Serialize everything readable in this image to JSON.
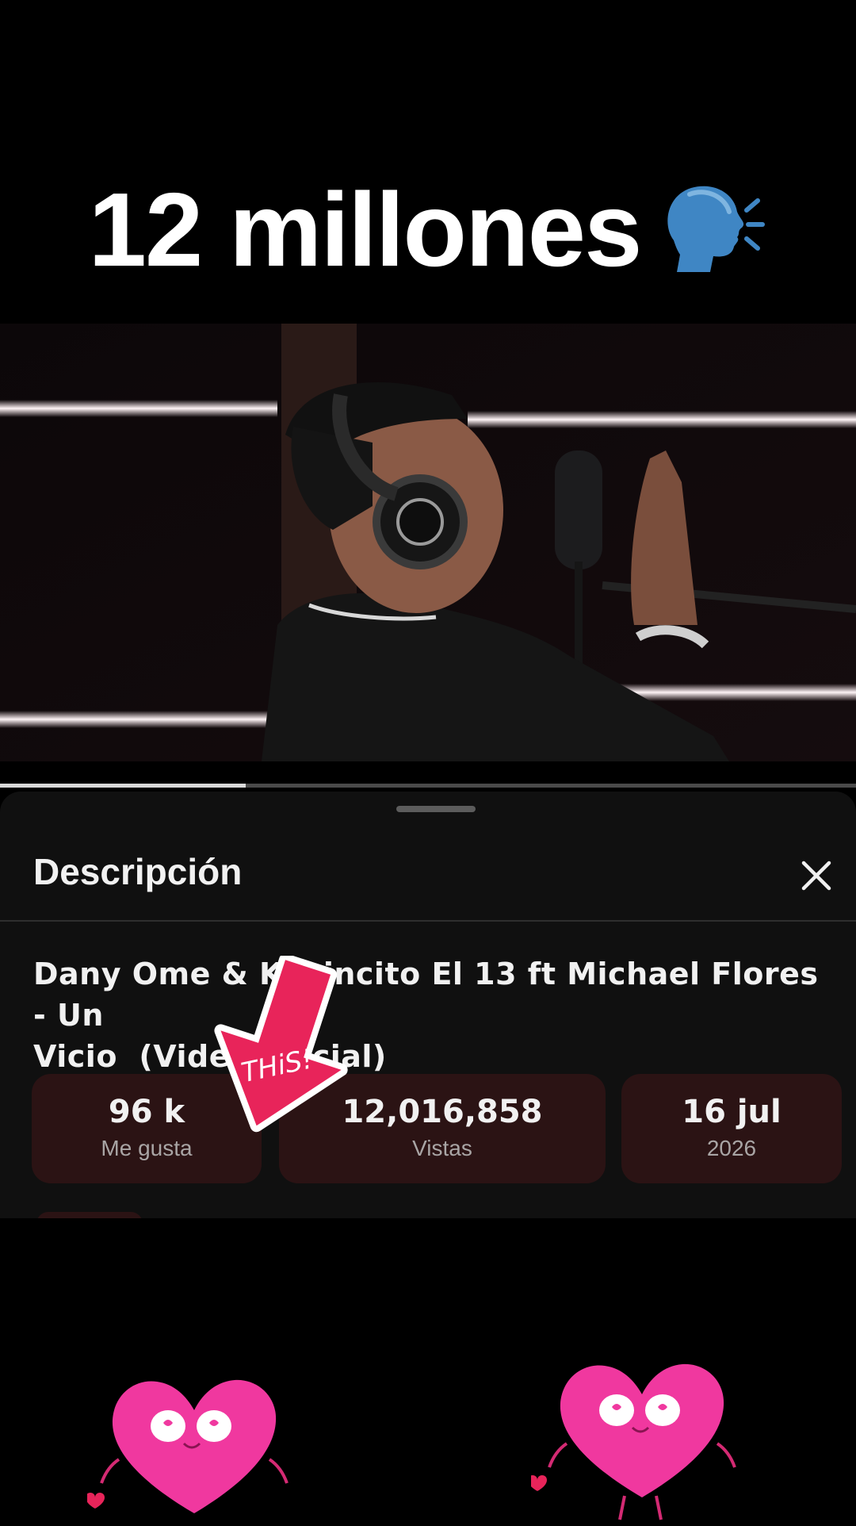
{
  "overlay": {
    "caption": "12 millones",
    "caption_icon": "speaking-head-icon"
  },
  "video": {
    "progress": 0.287
  },
  "description_sheet": {
    "title": "Descripción",
    "close_icon": "close-icon",
    "video_title_line1": "Dany Ome & Kevincito El 13 ft Michael Flores - Un",
    "video_title_line2": "Vicio  (Video Oficial)",
    "stats": {
      "likes_value": "96 k",
      "likes_label": "Me gusta",
      "views_value": "12,016,858",
      "views_label": "Vistas",
      "date_value": "16 jul",
      "date_label": "2026"
    }
  },
  "sticker": {
    "text": "THiS!",
    "icon": "arrow-down-icon"
  },
  "colors": {
    "heart_pink": "#f0389f",
    "sticker_red": "#e8245a",
    "card_bg": "#2b1314"
  }
}
